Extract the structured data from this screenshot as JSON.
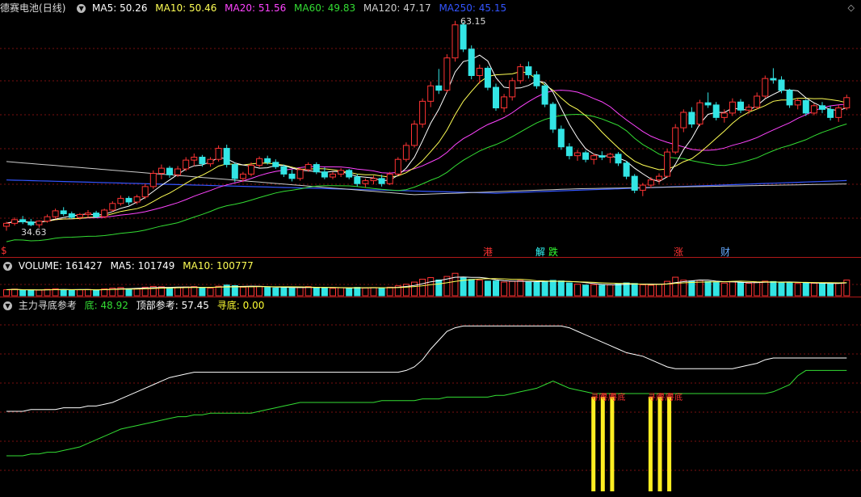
{
  "price_panel": {
    "stock_name": "德赛电池",
    "period": "(日线)",
    "ma_items": [
      {
        "label": "MA5: 50.26",
        "color": "#ffffff"
      },
      {
        "label": "MA10: 50.46",
        "color": "#ffff55"
      },
      {
        "label": "MA20: 51.56",
        "color": "#ff44ff"
      },
      {
        "label": "MA60: 49.83",
        "color": "#33dd33"
      },
      {
        "label": "MA120: 47.17",
        "color": "#cccccc"
      },
      {
        "label": "MA250: 45.15",
        "color": "#3355ff"
      }
    ],
    "high_label": "63.15",
    "low_label": "34.63",
    "events": [
      {
        "text": "港",
        "color": "#ff3333"
      },
      {
        "text": "解",
        "color": "#33ffff"
      },
      {
        "text": "跌",
        "color": "#33ff33"
      },
      {
        "text": "涨",
        "color": "#ff3333"
      },
      {
        "text": "财",
        "color": "#66aaff"
      }
    ],
    "left_marker": "$"
  },
  "volume_panel": {
    "items": [
      {
        "label": "VOLUME: 161427",
        "color": "#ffffff"
      },
      {
        "label": "MA5: 101749",
        "color": "#ffffff"
      },
      {
        "label": "MA10: 100777",
        "color": "#ffff55"
      }
    ]
  },
  "indicator_panel": {
    "name": "主力寻底参考",
    "items": [
      {
        "label": "底: 48.92",
        "color": "#33dd33"
      },
      {
        "label": "顶部参考: 57.45",
        "color": "#ffffff"
      },
      {
        "label": "寻底: 0.00",
        "color": "#ffff33"
      }
    ],
    "signal_text": "寻底"
  },
  "colors": {
    "up": "#ff3333",
    "down": "#33e5e5",
    "grid": "#7a0f0f",
    "separator": "#b01818"
  },
  "chart_data": {
    "type": "candlestick",
    "y_range": [
      33,
      64
    ],
    "candles": [
      [
        35.2,
        35.8,
        34.6,
        35.6
      ],
      [
        35.6,
        36.4,
        35.3,
        36.1
      ],
      [
        36.1,
        36.6,
        35.5,
        35.8
      ],
      [
        35.8,
        36.2,
        35.2,
        35.4
      ],
      [
        35.4,
        36.0,
        35.0,
        35.9
      ],
      [
        35.9,
        36.8,
        35.7,
        36.5
      ],
      [
        36.5,
        37.6,
        36.2,
        37.3
      ],
      [
        37.3,
        37.8,
        36.6,
        36.9
      ],
      [
        36.9,
        37.2,
        36.2,
        36.4
      ],
      [
        36.4,
        37.0,
        36.1,
        36.8
      ],
      [
        36.8,
        37.4,
        36.4,
        37.0
      ],
      [
        37.0,
        37.3,
        36.3,
        36.5
      ],
      [
        36.5,
        37.6,
        36.3,
        37.4
      ],
      [
        37.4,
        38.6,
        37.2,
        38.3
      ],
      [
        38.3,
        39.4,
        38.0,
        39.0
      ],
      [
        39.0,
        39.3,
        38.1,
        38.5
      ],
      [
        38.5,
        39.5,
        38.2,
        39.2
      ],
      [
        39.2,
        41.0,
        38.9,
        40.6
      ],
      [
        40.6,
        42.8,
        40.3,
        42.4
      ],
      [
        42.4,
        43.6,
        41.6,
        43.1
      ],
      [
        43.1,
        43.4,
        41.8,
        42.2
      ],
      [
        42.2,
        43.4,
        41.9,
        43.0
      ],
      [
        43.0,
        44.6,
        42.7,
        44.2
      ],
      [
        44.2,
        45.1,
        43.4,
        44.6
      ],
      [
        44.6,
        44.9,
        43.3,
        43.7
      ],
      [
        43.7,
        44.6,
        43.3,
        44.3
      ],
      [
        44.3,
        46.2,
        44.0,
        45.8
      ],
      [
        45.8,
        46.3,
        43.2,
        43.6
      ],
      [
        43.6,
        43.9,
        41.2,
        41.7
      ],
      [
        41.7,
        42.6,
        41.2,
        42.3
      ],
      [
        42.3,
        43.9,
        42.0,
        43.5
      ],
      [
        43.5,
        44.7,
        43.2,
        44.4
      ],
      [
        44.4,
        44.8,
        43.6,
        43.9
      ],
      [
        43.9,
        44.3,
        43.0,
        43.3
      ],
      [
        43.3,
        43.6,
        41.9,
        42.3
      ],
      [
        42.3,
        42.9,
        41.3,
        41.7
      ],
      [
        41.7,
        43.2,
        41.4,
        42.9
      ],
      [
        42.9,
        43.9,
        42.6,
        43.6
      ],
      [
        43.6,
        43.9,
        42.3,
        42.6
      ],
      [
        42.6,
        43.2,
        41.6,
        41.9
      ],
      [
        41.9,
        42.6,
        41.6,
        42.3
      ],
      [
        42.3,
        43.1,
        41.9,
        42.8
      ],
      [
        42.8,
        43.0,
        41.6,
        41.9
      ],
      [
        41.9,
        42.3,
        40.6,
        41.0
      ],
      [
        41.0,
        41.7,
        40.5,
        41.4
      ],
      [
        41.4,
        42.1,
        40.9,
        41.7
      ],
      [
        41.7,
        42.2,
        40.6,
        41.0
      ],
      [
        41.0,
        42.6,
        40.8,
        42.3
      ],
      [
        42.3,
        44.6,
        42.1,
        44.3
      ],
      [
        44.3,
        46.6,
        44.0,
        46.2
      ],
      [
        46.2,
        49.6,
        45.9,
        49.1
      ],
      [
        49.1,
        52.6,
        48.6,
        52.2
      ],
      [
        52.2,
        54.9,
        51.4,
        54.3
      ],
      [
        54.3,
        56.6,
        53.2,
        53.7
      ],
      [
        53.7,
        58.6,
        53.4,
        58.1
      ],
      [
        58.1,
        63.15,
        57.6,
        62.6
      ],
      [
        62.6,
        63.0,
        58.9,
        59.3
      ],
      [
        59.3,
        59.8,
        55.2,
        55.7
      ],
      [
        55.7,
        57.2,
        54.6,
        56.7
      ],
      [
        56.7,
        57.0,
        53.7,
        54.1
      ],
      [
        54.1,
        54.6,
        50.9,
        51.3
      ],
      [
        51.3,
        53.2,
        50.7,
        52.8
      ],
      [
        52.8,
        55.4,
        52.3,
        55.0
      ],
      [
        55.0,
        57.3,
        54.6,
        56.9
      ],
      [
        56.9,
        57.6,
        55.3,
        55.8
      ],
      [
        55.8,
        56.3,
        53.9,
        54.3
      ],
      [
        54.3,
        54.6,
        51.4,
        51.8
      ],
      [
        51.8,
        52.1,
        47.9,
        48.4
      ],
      [
        48.4,
        48.9,
        45.6,
        46.0
      ],
      [
        46.0,
        46.5,
        44.3,
        44.8
      ],
      [
        44.8,
        45.6,
        44.1,
        45.2
      ],
      [
        45.2,
        45.5,
        43.9,
        44.3
      ],
      [
        44.3,
        45.1,
        43.6,
        44.8
      ],
      [
        44.8,
        45.4,
        44.2,
        44.6
      ],
      [
        44.6,
        45.2,
        43.8,
        45.0
      ],
      [
        45.0,
        45.3,
        43.4,
        43.8
      ],
      [
        43.8,
        44.1,
        41.6,
        42.0
      ],
      [
        42.0,
        42.3,
        39.7,
        40.1
      ],
      [
        40.1,
        41.1,
        39.3,
        40.8
      ],
      [
        40.8,
        41.9,
        40.4,
        41.5
      ],
      [
        41.5,
        42.4,
        41.0,
        42.0
      ],
      [
        42.0,
        45.7,
        41.8,
        45.3
      ],
      [
        45.3,
        49.1,
        45.0,
        48.6
      ],
      [
        48.6,
        51.1,
        48.0,
        50.7
      ],
      [
        50.7,
        51.4,
        48.6,
        49.1
      ],
      [
        49.1,
        52.4,
        48.8,
        52.0
      ],
      [
        52.0,
        53.4,
        51.3,
        51.7
      ],
      [
        51.7,
        52.1,
        49.6,
        50.0
      ],
      [
        50.0,
        51.1,
        49.3,
        50.6
      ],
      [
        50.6,
        52.6,
        50.2,
        52.1
      ],
      [
        52.1,
        52.5,
        50.6,
        51.0
      ],
      [
        51.0,
        51.8,
        50.5,
        51.4
      ],
      [
        51.4,
        53.4,
        51.1,
        52.9
      ],
      [
        52.9,
        55.7,
        52.6,
        55.3
      ],
      [
        55.3,
        56.7,
        54.6,
        55.1
      ],
      [
        55.1,
        55.6,
        53.3,
        53.7
      ],
      [
        53.7,
        53.9,
        51.3,
        51.7
      ],
      [
        51.7,
        52.6,
        51.1,
        52.3
      ],
      [
        52.3,
        52.5,
        50.2,
        50.6
      ],
      [
        50.6,
        51.9,
        50.3,
        51.6
      ],
      [
        51.6,
        52.1,
        50.6,
        51.1
      ],
      [
        51.1,
        51.6,
        49.6,
        50.0
      ],
      [
        50.0,
        51.7,
        49.4,
        51.3
      ],
      [
        51.3,
        53.1,
        51.0,
        52.7
      ]
    ],
    "volume_range": [
      0,
      320000
    ],
    "volumes": [
      62,
      68,
      55,
      60,
      58,
      66,
      72,
      63,
      57,
      61,
      64,
      59,
      70,
      78,
      84,
      72,
      75,
      88,
      96,
      92,
      80,
      85,
      90,
      94,
      82,
      79,
      98,
      110,
      104,
      88,
      92,
      96,
      86,
      80,
      84,
      78,
      90,
      94,
      82,
      80,
      76,
      82,
      78,
      86,
      80,
      84,
      82,
      88,
      102,
      118,
      140,
      170,
      186,
      162,
      198,
      230,
      184,
      168,
      160,
      150,
      152,
      140,
      148,
      156,
      142,
      138,
      150,
      158,
      152,
      132,
      118,
      110,
      114,
      108,
      112,
      120,
      132,
      126,
      112,
      108,
      118,
      148,
      190,
      160,
      150,
      158,
      146,
      136,
      130,
      142,
      136,
      128,
      140,
      150,
      146,
      138,
      134,
      126,
      132,
      128,
      124,
      120,
      130,
      161
    ],
    "bottom_ref": [
      20,
      20,
      20,
      21,
      21,
      22,
      22,
      23,
      24,
      25,
      27,
      29,
      31,
      33,
      35,
      36,
      37,
      38,
      39,
      40,
      41,
      42,
      42,
      43,
      43,
      44,
      44,
      44,
      44,
      44,
      44,
      45,
      46,
      47,
      48,
      49,
      50,
      50,
      50,
      50,
      50,
      50,
      50,
      50,
      50,
      50,
      51,
      51,
      51,
      51,
      51,
      52,
      52,
      52,
      53,
      53,
      53,
      53,
      53,
      53,
      54,
      54,
      55,
      56,
      57,
      58,
      60,
      62,
      60,
      58,
      57,
      56,
      55,
      55,
      55,
      55,
      55,
      55,
      55,
      55,
      55,
      55,
      55,
      55,
      55,
      55,
      55,
      55,
      55,
      55,
      55,
      55,
      55,
      55,
      56,
      58,
      60,
      65,
      68,
      68,
      68,
      68,
      68,
      68
    ],
    "top_ref": [
      45,
      45,
      45,
      46,
      46,
      46,
      46,
      47,
      47,
      47,
      48,
      48,
      49,
      50,
      52,
      54,
      56,
      58,
      60,
      62,
      64,
      65,
      66,
      67,
      67,
      67,
      67,
      67,
      67,
      67,
      67,
      67,
      67,
      67,
      67,
      67,
      67,
      67,
      67,
      67,
      67,
      67,
      67,
      67,
      67,
      67,
      67,
      67,
      67,
      68,
      70,
      74,
      80,
      85,
      90,
      92,
      93,
      93,
      93,
      93,
      93,
      93,
      93,
      93,
      93,
      93,
      93,
      93,
      93,
      92,
      90,
      88,
      86,
      84,
      82,
      80,
      78,
      77,
      76,
      74,
      72,
      70,
      69,
      69,
      69,
      69,
      69,
      69,
      69,
      69,
      70,
      71,
      72,
      74,
      75,
      75,
      75,
      75,
      75,
      75,
      75,
      75,
      75,
      75
    ],
    "signals": [
      72,
      73,
      74,
      79,
      80,
      81
    ]
  }
}
